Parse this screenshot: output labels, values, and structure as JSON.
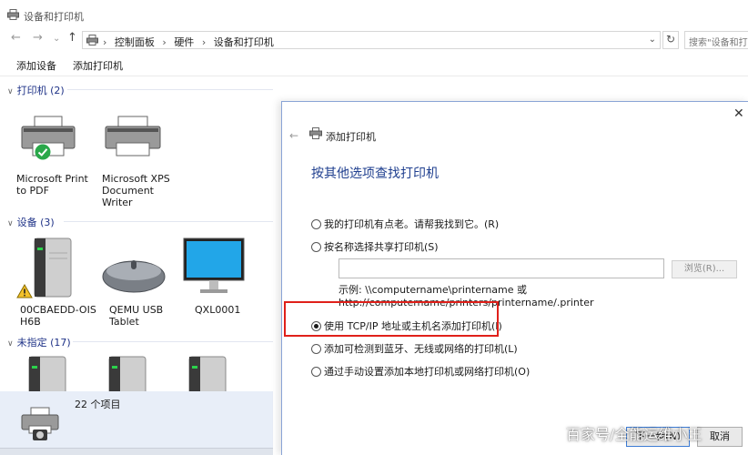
{
  "window": {
    "title": "设备和打印机"
  },
  "nav": {
    "back": "←",
    "forward": "→",
    "recent": "⌄",
    "up": "↑",
    "breadcrumb": [
      "控制面板",
      "硬件",
      "设备和打印机"
    ],
    "search_placeholder": "搜索\"设备和打印机\""
  },
  "toolbar": {
    "add_device": "添加设备",
    "add_printer": "添加打印机"
  },
  "groups": {
    "printers": {
      "label": "打印机 (2)"
    },
    "devices": {
      "label": "设备 (3)"
    },
    "unspecified": {
      "label": "未指定 (17)"
    }
  },
  "printers": [
    {
      "name": "Microsoft Print to PDF",
      "lines": [
        "Microsoft Print",
        "to PDF"
      ],
      "default": true
    },
    {
      "name": "Microsoft XPS Document Writer",
      "lines": [
        "Microsoft XPS",
        "Document",
        "Writer"
      ]
    }
  ],
  "devices": [
    {
      "lines": [
        "00CBAEDD-OIS",
        "H6B"
      ],
      "icon": "server-tower-icon",
      "warning": true
    },
    {
      "lines": [
        "QEMU USB",
        "Tablet"
      ],
      "icon": "mouse-icon"
    },
    {
      "lines": [
        "QXL0001"
      ],
      "icon": "monitor-icon"
    }
  ],
  "details": {
    "count": "22 个项目"
  },
  "dialog": {
    "title": "添加打印机",
    "heading": "按其他选项查找打印机",
    "options": [
      {
        "label": "我的打印机有点老。请帮我找到它。(R)",
        "selected": false
      },
      {
        "label": "按名称选择共享打印机(S)",
        "selected": false
      },
      {
        "label": "使用 TCP/IP 地址或主机名添加打印机(I)",
        "selected": true
      },
      {
        "label": "添加可检测到蓝牙、无线或网络的打印机(L)",
        "selected": false
      },
      {
        "label": "通过手动设置添加本地打印机或网络打印机(O)",
        "selected": false
      }
    ],
    "name_input_value": "",
    "browse_label": "浏览(R)...",
    "example_line1": "示例: \\\\computername\\printername 或",
    "example_line2": "http://computername/printers/printername/.printer",
    "next_label": "下一步(N)",
    "cancel_label": "取消"
  },
  "watermark": "百家号/全能运维小王",
  "colors": {
    "accent": "#1f3f8f",
    "highlight": "#e0201a",
    "details_bg": "#e8eef8"
  }
}
